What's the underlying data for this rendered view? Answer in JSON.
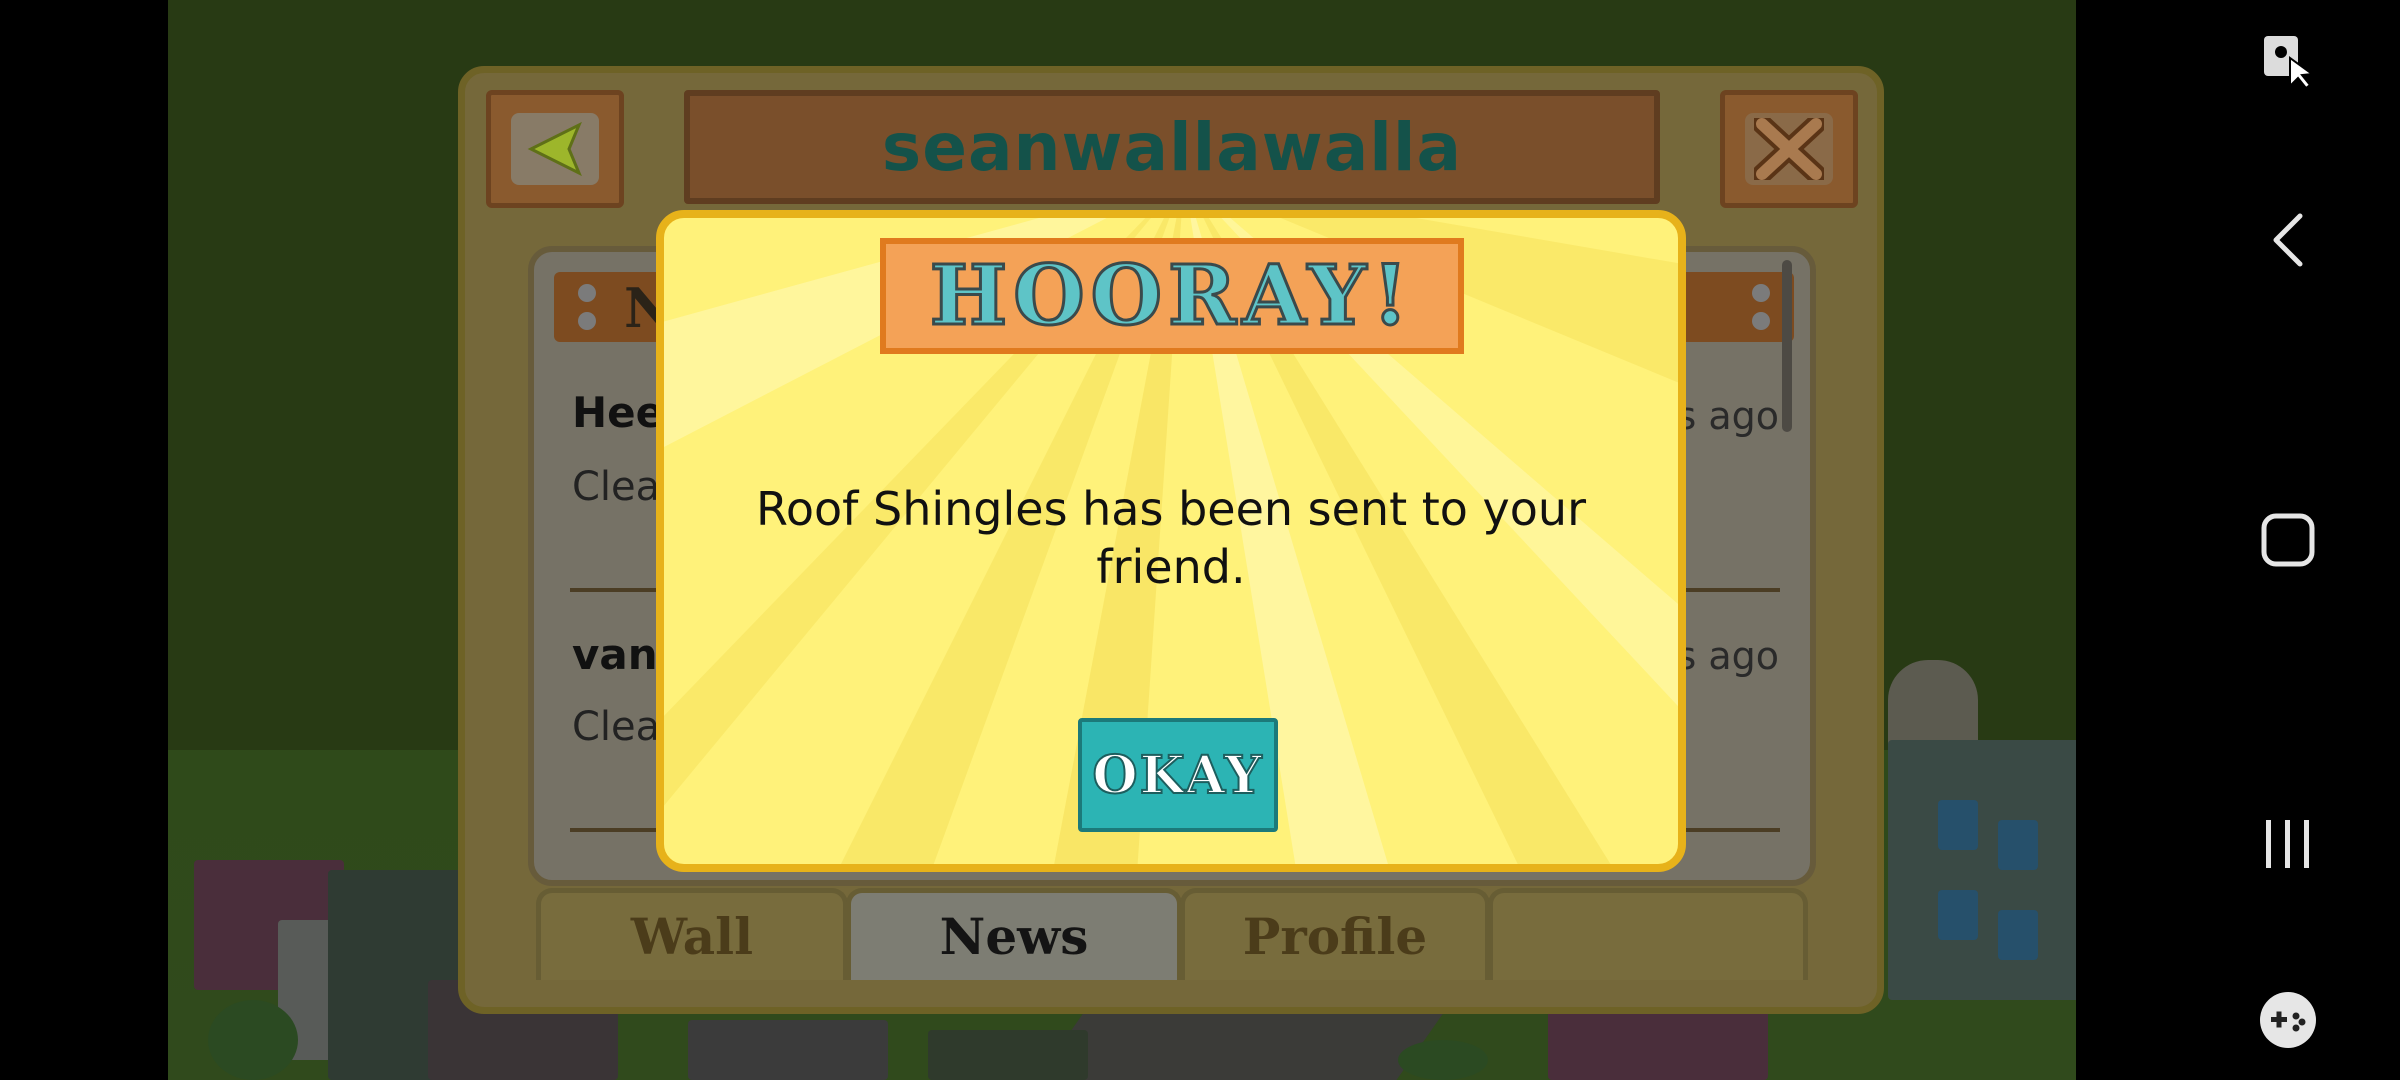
{
  "panel": {
    "title": "seanwallawalla",
    "back_icon": "left-arrow-icon",
    "close_icon": "close-x-icon",
    "header_visible_char": "N",
    "feed": [
      {
        "name": "Heel",
        "text": "Clean",
        "time": "ys ago"
      },
      {
        "name": "van",
        "text": "Clean",
        "time": "ys ago"
      }
    ],
    "tabs": [
      {
        "label": "Wall",
        "active": false
      },
      {
        "label": "News",
        "active": true
      },
      {
        "label": "Profile",
        "active": false
      },
      {
        "label": "",
        "active": false
      }
    ]
  },
  "dialog": {
    "banner": "HOORAY!",
    "message": "Roof Shingles has been sent to your friend.",
    "okay_label": "OKAY"
  },
  "navbar": {
    "icons": [
      "screen-lock-icon",
      "back-icon",
      "home-icon",
      "recents-icon",
      "game-controller-icon"
    ]
  },
  "colors": {
    "title_text": "#14524a",
    "dialog_bg": "#fff27a",
    "dialog_border": "#e7b21a",
    "okay_button": "#2cb4b4",
    "banner_bg": "#f4a257"
  }
}
